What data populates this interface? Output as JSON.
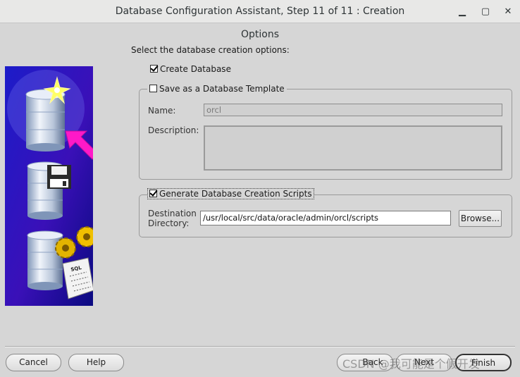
{
  "window": {
    "title": "Database Configuration Assistant, Step 11 of 11 : Creation Options",
    "minimize": "▁",
    "maximize": "▢",
    "close": "✕"
  },
  "main": {
    "prompt": "Select the database creation options:",
    "create_database": {
      "label": "Create Database",
      "checked": true
    },
    "template_group": {
      "label": "Save as a Database Template",
      "checked": false,
      "name_label": "Name:",
      "name_value": "orcl",
      "description_label": "Description:",
      "description_value": ""
    },
    "scripts_group": {
      "label": "Generate Database Creation Scripts",
      "checked": true,
      "destination_label_1": "Destination",
      "destination_label_2": "Directory:",
      "destination_value": "/usr/local/src/data/oracle/admin/orcl/scripts",
      "browse_label": "Browse..."
    }
  },
  "footer": {
    "cancel": "Cancel",
    "help": "Help",
    "back": "Back",
    "next": "Next",
    "finish": "Finish"
  },
  "illustration": {
    "sql_text": "SQL"
  },
  "watermark": "CSDN @我可能是个假开发",
  "colors": {
    "illus_bg_top": "#1a1ab8",
    "illus_bg_bottom": "#0b0b8a",
    "arrow": "#ff19c8",
    "gear": "#e2b400"
  }
}
